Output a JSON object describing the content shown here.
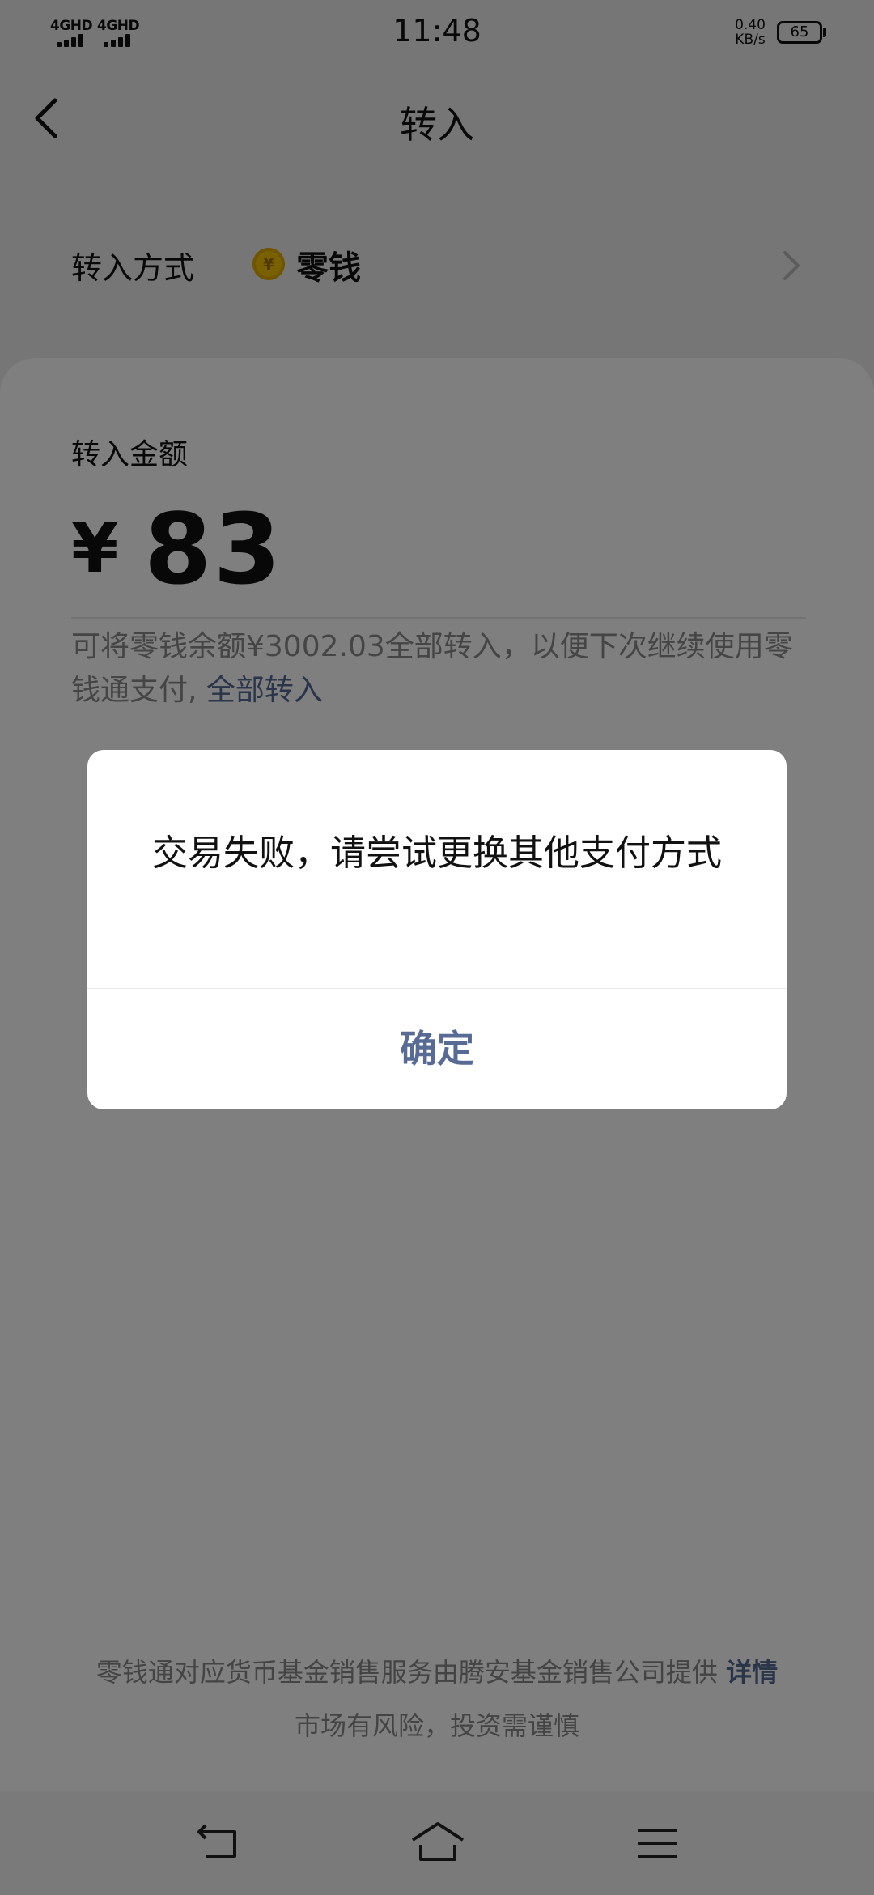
{
  "status_bar": {
    "sim1_label": "4GHD",
    "sim2_label": "4GHD",
    "time": "11:48",
    "net_speed_value": "0.40",
    "net_speed_unit": "KB/s",
    "battery_level": "65"
  },
  "nav": {
    "title": "转入",
    "back_icon": "chevron-left-icon"
  },
  "method": {
    "label": "转入方式",
    "coin_symbol": "¥",
    "value": "零钱",
    "chevron_icon": "chevron-right-icon"
  },
  "amount": {
    "label": "转入金额",
    "currency": "¥",
    "value": "83"
  },
  "hint": {
    "text": "可将零钱余额¥3002.03全部转入，以便下次继续使用零钱通支付,",
    "link": "全部转入"
  },
  "footer": {
    "line1": "零钱通对应货币基金销售服务由腾安基金销售公司提供",
    "link": "详情",
    "line2": "市场有风险，投资需谨慎"
  },
  "system_nav": {
    "back_icon": "system-back-icon",
    "home_icon": "home-icon",
    "menu_icon": "menu-icon"
  },
  "dialog": {
    "message": "交易失败，请尝试更换其他支付方式",
    "confirm_label": "确定"
  },
  "colors": {
    "link": "#576b95",
    "coin": "#f2c200",
    "mask": "rgba(0,0,0,0.5)"
  }
}
